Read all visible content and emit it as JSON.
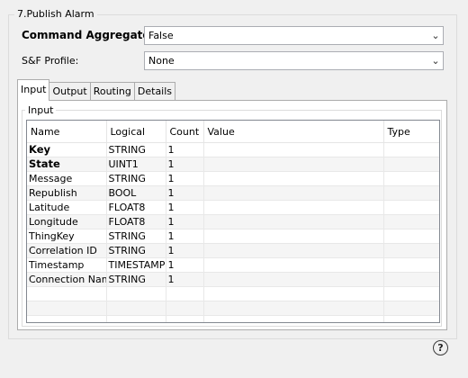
{
  "group": {
    "title": "7.Publish Alarm"
  },
  "fields": {
    "command_aggregator": {
      "label": "Command Aggregator:",
      "value": "False"
    },
    "sf_profile": {
      "label": "S&F Profile:",
      "value": "None"
    }
  },
  "tabs": [
    {
      "label": "Input",
      "active": true
    },
    {
      "label": "Output"
    },
    {
      "label": "Routing"
    },
    {
      "label": "Details"
    }
  ],
  "input_group": {
    "title": "Input"
  },
  "table": {
    "columns": [
      "Name",
      "Logical",
      "Count",
      "Value",
      "Type"
    ],
    "rows": [
      {
        "name": "Key",
        "logical": "STRING",
        "count": "1",
        "value": "",
        "type": "",
        "bold": true
      },
      {
        "name": "State",
        "logical": "UINT1",
        "count": "1",
        "value": "",
        "type": "",
        "bold": true
      },
      {
        "name": "Message",
        "logical": "STRING",
        "count": "1",
        "value": "",
        "type": ""
      },
      {
        "name": "Republish",
        "logical": "BOOL",
        "count": "1",
        "value": "",
        "type": ""
      },
      {
        "name": "Latitude",
        "logical": "FLOAT8",
        "count": "1",
        "value": "",
        "type": ""
      },
      {
        "name": "Longitude",
        "logical": "FLOAT8",
        "count": "1",
        "value": "",
        "type": ""
      },
      {
        "name": "ThingKey",
        "logical": "STRING",
        "count": "1",
        "value": "",
        "type": ""
      },
      {
        "name": "Correlation ID",
        "logical": "STRING",
        "count": "1",
        "value": "",
        "type": ""
      },
      {
        "name": "Timestamp",
        "logical": "TIMESTAMP",
        "count": "1",
        "value": "",
        "type": ""
      },
      {
        "name": "Connection Name",
        "logical": "STRING",
        "count": "1",
        "value": "",
        "type": ""
      }
    ]
  },
  "help": {
    "icon": "help-icon",
    "glyph": "?"
  }
}
